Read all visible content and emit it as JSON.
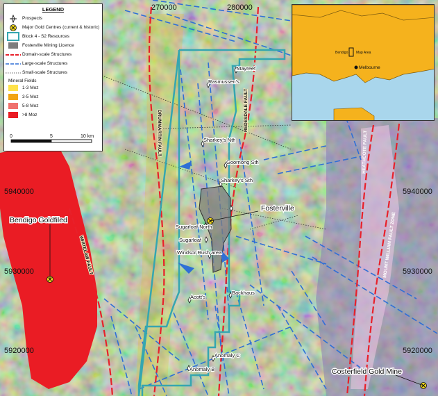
{
  "legend": {
    "title": "LEGEND",
    "items": [
      {
        "label": "Prospects"
      },
      {
        "label": "Major Gold Centres (current & historic)"
      },
      {
        "label": "Block 4 - S2 Resources"
      },
      {
        "label": "Fosterville Mining Licence"
      },
      {
        "label": "Domain-scale Structures"
      },
      {
        "label": "Large-scale Structures"
      },
      {
        "label": "Small-scale Structures"
      }
    ],
    "mineral_fields_title": "Mineral Fields",
    "mineral_fields": [
      {
        "label": "1-3 Moz",
        "color": "#ffe24a"
      },
      {
        "label": "3-5 Moz",
        "color": "#f2a413"
      },
      {
        "label": "5-8 Moz",
        "color": "#f0706d"
      },
      {
        "label": ">8 Moz",
        "color": "#ea1c24"
      }
    ],
    "scale": {
      "start": "0",
      "mid": "5",
      "end": "10 km"
    }
  },
  "grid": {
    "eastings": [
      "270000",
      "280000"
    ],
    "northings_left": [
      "5940000",
      "5930000",
      "5920000"
    ],
    "northings_right": [
      "5940000",
      "5930000",
      "5920000"
    ]
  },
  "prospects": [
    "Mayreef",
    "Rasmussen's",
    "Sharkey's Nth",
    "Goornong Sth",
    "Sharkey's Sth",
    "Sugarloaf North",
    "Sugarloaf",
    "Windsor Rush area",
    "Backhaus",
    "Acott's",
    "Anomaly C",
    "Anomaly B"
  ],
  "gold_centres": [
    "Fosterville",
    "Bendigo Goldfiled",
    "Costerfield Gold Mine"
  ],
  "faults": [
    "DRUMMARTIN FAULT",
    "REDESDALE FAULT",
    "WHITELAW FAULT",
    "HEATHCOTE FAULT",
    "MOUNT WILLIAM FAULT ZONE"
  ],
  "inset": {
    "map_area": "Map Area",
    "bendigo": "Bendigo",
    "melbourne": "Melbourne"
  },
  "colors": {
    "domain": "#e8202a",
    "large": "#2f6fd6",
    "small": "#333333",
    "block4": "#35a6b0",
    "licence": "#7d7d7d",
    "land": "#f5b21d"
  }
}
